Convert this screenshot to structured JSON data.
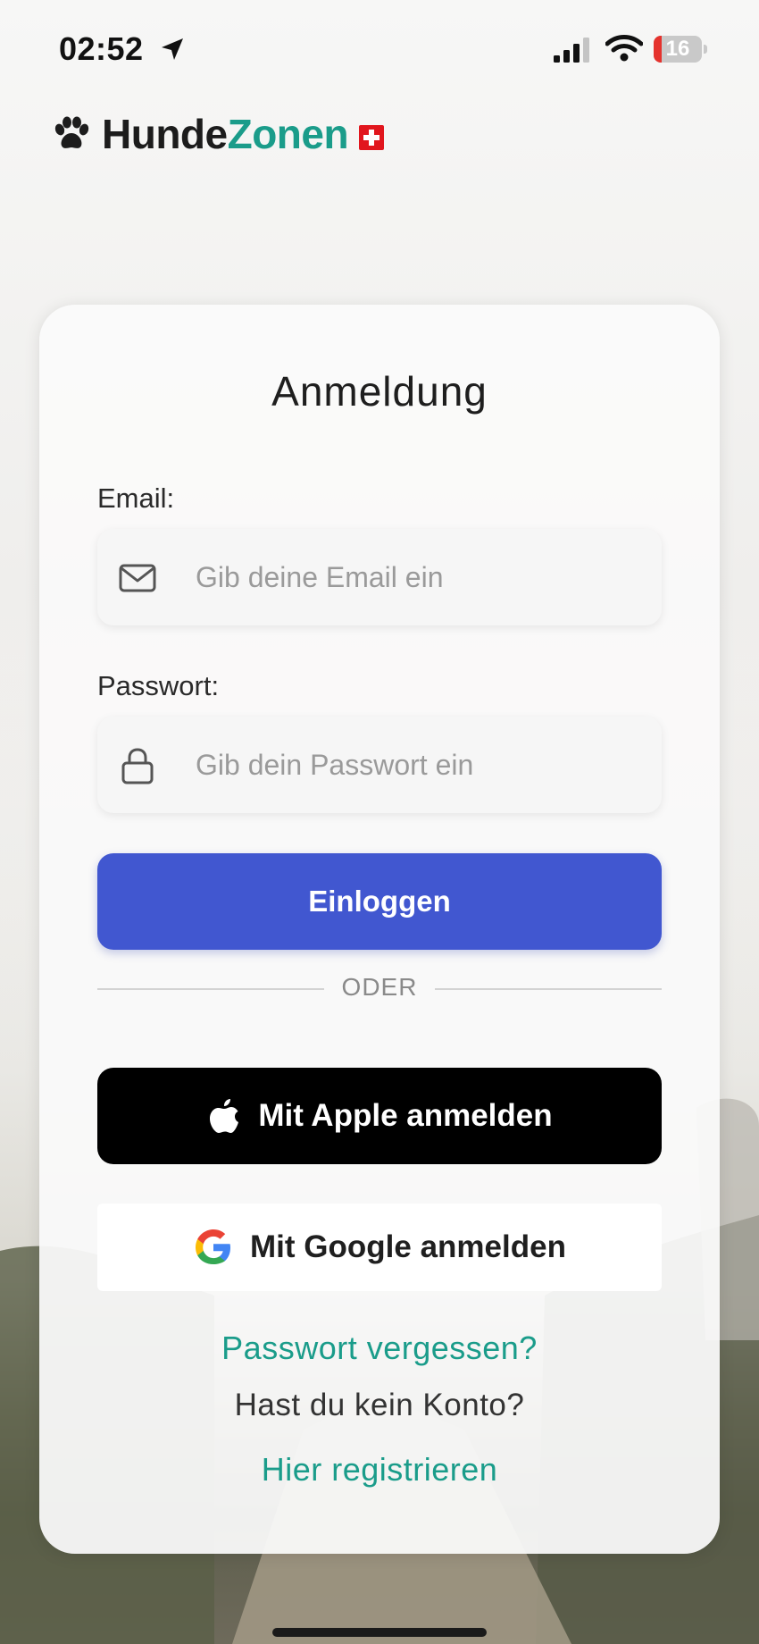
{
  "status_bar": {
    "time": "02:52",
    "battery_level": "16",
    "battery_fill_fraction": 0.16
  },
  "brand": {
    "name_part1": "Hunde",
    "name_part2": "Zonen",
    "colors": {
      "dark": "#1c1c1c",
      "accent": "#1a9c8a"
    },
    "logo_icon": "paw-icon",
    "flag_icon": "swiss-flag-icon"
  },
  "login": {
    "title": "Anmeldung",
    "email": {
      "label": "Email:",
      "placeholder": "Gib deine Email ein",
      "value": "",
      "icon": "envelope-icon"
    },
    "password": {
      "label": "Passwort:",
      "placeholder": "Gib dein Passwort ein",
      "value": "",
      "icon": "lock-icon"
    },
    "submit_label": "Einloggen",
    "submit_color": "#4157d0",
    "divider_text": "ODER",
    "apple_label": "Mit Apple anmelden",
    "google_label": "Mit Google anmelden",
    "forgot_password": "Passwort vergessen?",
    "no_account": "Hast du kein Konto?",
    "register": "Hier registrieren"
  }
}
